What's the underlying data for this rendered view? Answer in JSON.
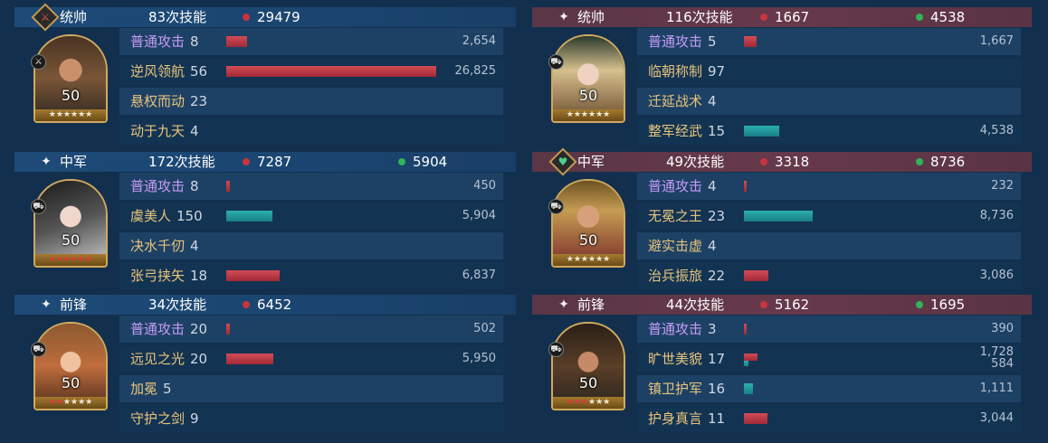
{
  "left": {
    "units": [
      {
        "role": "统帅",
        "role_icon": "sword-badge-icon",
        "skill_count": "83次技能",
        "damage": "29479",
        "heal": "",
        "level": "50",
        "stars": [
          1,
          1,
          1,
          1,
          1,
          1
        ],
        "red_stars": 0,
        "faction_icon": "sword-icon",
        "skills": [
          {
            "name": "普通攻击",
            "count": "8",
            "value": "2,654",
            "damage_ratio": 0.099,
            "basic": true
          },
          {
            "name": "逆风领航",
            "count": "56",
            "value": "26,825",
            "damage_ratio": 1.0
          },
          {
            "name": "悬权而动",
            "count": "23",
            "value": ""
          },
          {
            "name": "动于九天",
            "count": "4",
            "value": ""
          }
        ]
      },
      {
        "role": "中军",
        "role_icon": "sparkle-icon",
        "skill_count": "172次技能",
        "damage": "7287",
        "heal": "5904",
        "level": "50",
        "stars": [
          1,
          1,
          1,
          1,
          1,
          1
        ],
        "red_stars": 6,
        "faction_icon": "chariot-icon",
        "skills": [
          {
            "name": "普通攻击",
            "count": "8",
            "value": "450",
            "damage_ratio": 0.017,
            "basic": true
          },
          {
            "name": "虞美人",
            "count": "150",
            "value": "5,904",
            "heal_ratio": 0.22
          },
          {
            "name": "决水千仞",
            "count": "4",
            "value": ""
          },
          {
            "name": "张弓挟矢",
            "count": "18",
            "value": "6,837",
            "damage_ratio": 0.255
          }
        ]
      },
      {
        "role": "前锋",
        "role_icon": "sparkle-icon",
        "skill_count": "34次技能",
        "damage": "6452",
        "heal": "",
        "level": "50",
        "stars": [
          1,
          1,
          1,
          1,
          1,
          1
        ],
        "red_stars": 2,
        "faction_icon": "chariot-icon",
        "skills": [
          {
            "name": "普通攻击",
            "count": "20",
            "value": "502",
            "damage_ratio": 0.019,
            "basic": true
          },
          {
            "name": "远见之光",
            "count": "20",
            "value": "5,950",
            "damage_ratio": 0.222
          },
          {
            "name": "加冕",
            "count": "5",
            "value": ""
          },
          {
            "name": "守护之剑",
            "count": "9",
            "value": ""
          }
        ]
      }
    ]
  },
  "right": {
    "units": [
      {
        "role": "统帅",
        "role_icon": "sparkle-icon",
        "skill_count": "116次技能",
        "damage": "1667",
        "heal": "4538",
        "level": "50",
        "stars": [
          1,
          1,
          1,
          1,
          1,
          1
        ],
        "red_stars": 0,
        "faction_icon": "chariot-icon",
        "skills": [
          {
            "name": "普通攻击",
            "count": "5",
            "value": "1,667",
            "damage_ratio": 0.062,
            "basic": true
          },
          {
            "name": "临朝称制",
            "count": "97",
            "value": ""
          },
          {
            "name": "迁延战术",
            "count": "4",
            "value": ""
          },
          {
            "name": "整军经武",
            "count": "15",
            "value": "4,538",
            "heal_ratio": 0.169
          }
        ]
      },
      {
        "role": "中军",
        "role_icon": "heart-badge-icon",
        "skill_count": "49次技能",
        "damage": "3318",
        "heal": "8736",
        "level": "50",
        "stars": [
          1,
          1,
          1,
          1,
          1,
          1
        ],
        "red_stars": 0,
        "faction_icon": "chariot-icon",
        "skills": [
          {
            "name": "普通攻击",
            "count": "4",
            "value": "232",
            "damage_ratio": 0.009,
            "basic": true
          },
          {
            "name": "无冕之王",
            "count": "23",
            "value": "8,736",
            "heal_ratio": 0.326
          },
          {
            "name": "避实击虚",
            "count": "4",
            "value": ""
          },
          {
            "name": "治兵振旅",
            "count": "22",
            "value": "3,086",
            "damage_ratio": 0.115
          }
        ]
      },
      {
        "role": "前锋",
        "role_icon": "sparkle-icon",
        "skill_count": "44次技能",
        "damage": "5162",
        "heal": "1695",
        "level": "50",
        "stars": [
          1,
          1,
          1,
          1,
          1,
          1
        ],
        "red_stars": 3,
        "faction_icon": "chariot-icon",
        "skills": [
          {
            "name": "普通攻击",
            "count": "3",
            "value": "390",
            "damage_ratio": 0.015,
            "basic": true
          },
          {
            "name": "旷世美貌",
            "count": "17",
            "value": "1,728",
            "value2": "584",
            "damage_ratio": 0.064,
            "heal_ratio": 0.022
          },
          {
            "name": "镇卫护军",
            "count": "16",
            "value": "1,111",
            "heal_ratio": 0.041
          },
          {
            "name": "护身真言",
            "count": "11",
            "value": "3,044",
            "damage_ratio": 0.113
          }
        ]
      }
    ]
  },
  "colors": {
    "damage": "#c8343f",
    "heal": "#2fb45a",
    "skill_name": "#e7c47a",
    "basic_attack": "#c59bf5"
  }
}
